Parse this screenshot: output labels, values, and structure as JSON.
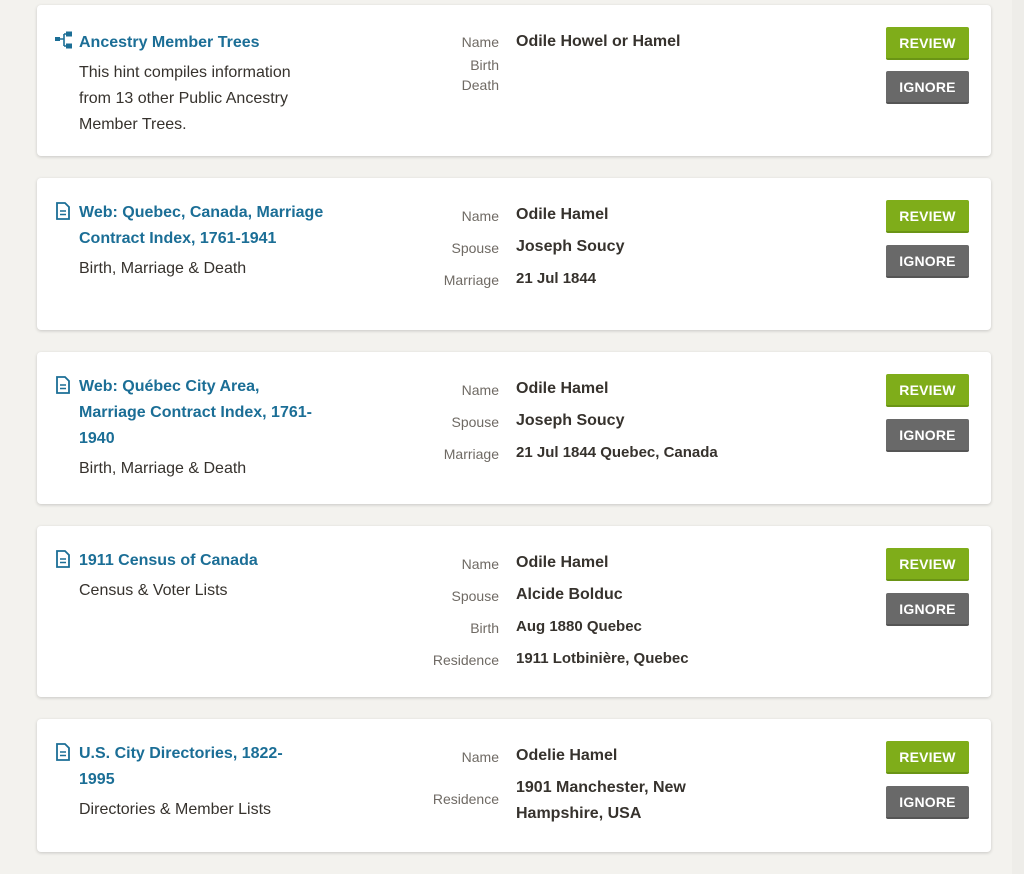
{
  "hints": [
    {
      "source_icon": "family-tree-icon",
      "title": "Ancestry Member Trees",
      "subtitle": "This hint compiles information from 13 other Public Ancestry Member Trees.",
      "fields": [
        {
          "label": "Name",
          "value": "Odile Howel or Hamel"
        },
        {
          "label": "Birth",
          "value": ""
        },
        {
          "label": "Death",
          "value": ""
        }
      ],
      "review_label": "REVIEW",
      "ignore_label": "IGNORE"
    },
    {
      "source_icon": "document-icon",
      "title": "Web: Quebec, Canada, Marriage Contract Index, 1761-1941",
      "subtitle": "Birth, Marriage & Death",
      "fields": [
        {
          "label": "Name",
          "value": "Odile Hamel"
        },
        {
          "label": "Spouse",
          "value": "Joseph Soucy"
        },
        {
          "label": "Marriage",
          "value": "21 Jul 1844"
        }
      ],
      "review_label": "REVIEW",
      "ignore_label": "IGNORE"
    },
    {
      "source_icon": "document-icon",
      "title": "Web: Québec City Area, Marriage Contract Index, 1761-1940",
      "subtitle": "Birth, Marriage & Death",
      "fields": [
        {
          "label": "Name",
          "value": "Odile Hamel"
        },
        {
          "label": "Spouse",
          "value": "Joseph Soucy"
        },
        {
          "label": "Marriage",
          "value": "21 Jul 1844 Quebec, Canada"
        }
      ],
      "review_label": "REVIEW",
      "ignore_label": "IGNORE"
    },
    {
      "source_icon": "document-icon",
      "title": "1911 Census of Canada",
      "subtitle": "Census & Voter Lists",
      "fields": [
        {
          "label": "Name",
          "value": "Odile Hamel"
        },
        {
          "label": "Spouse",
          "value": "Alcide Bolduc"
        },
        {
          "label": "Birth",
          "value": "Aug 1880 Quebec"
        },
        {
          "label": "Residence",
          "value": "1911 Lotbinière, Quebec"
        }
      ],
      "review_label": "REVIEW",
      "ignore_label": "IGNORE"
    },
    {
      "source_icon": "document-icon",
      "title": "U.S. City Directories, 1822-1995",
      "subtitle": "Directories & Member Lists",
      "fields": [
        {
          "label": "Name",
          "value": "Odelie Hamel"
        },
        {
          "label": "Residence",
          "value": "1901 Manchester, New Hampshire, USA"
        }
      ],
      "review_label": "REVIEW",
      "ignore_label": "IGNORE"
    }
  ],
  "colors": {
    "link": "#1b6e96",
    "review": "#7fad1a",
    "ignore": "#696969"
  }
}
